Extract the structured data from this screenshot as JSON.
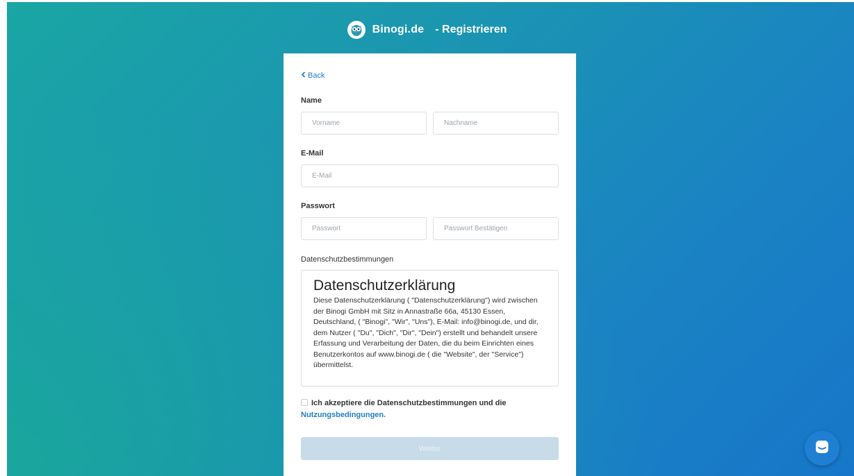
{
  "header": {
    "brand": "Binogi.de",
    "page_title": "- Registrieren"
  },
  "form": {
    "back_label": "Back",
    "name_label": "Name",
    "first_name_placeholder": "Vorname",
    "last_name_placeholder": "Nachname",
    "email_label": "E-Mail",
    "email_placeholder": "E-Mail",
    "password_label": "Passwort",
    "password_placeholder": "Passwort",
    "password_confirm_placeholder": "Passwort Bestätigen",
    "privacy_label": "Datenschutzbestimmungen",
    "privacy_title": "Datenschutzerklärung",
    "privacy_text": "Diese Datenschutzerklärung ( \"Datenschutzerklärung\") wird zwischen der Binogi GmbH mit Sitz in Annastraße 66a, 45130 Essen, Deutschland, ( \"Binogi\", \"Wir\", \"Uns\"), E-Mail: info@binogi.de, und dir, dem Nutzer ( \"Du\", \"Dich\", \"Dir\", \"Dein\") erstellt und behandelt unsere Erfassung und Verarbeitung der Daten, die du beim Einrichten eines Benutzerkontos auf www.binogi.de ( die \"Website\", der \"Service\") übermittelst.",
    "consent_text": "Ich akzeptiere die Datenschutzbestimmungen und die",
    "terms_link": "Nutzungsbedingungen.",
    "submit_label": "Weiter"
  },
  "icons": {
    "logo": "owl-logo-icon",
    "back": "chevron-left-icon",
    "chat": "chat-icon"
  },
  "colors": {
    "accent": "#1e7fc2",
    "submit_disabled": "#c7dbe9",
    "chat_button": "#1f7fd3"
  }
}
